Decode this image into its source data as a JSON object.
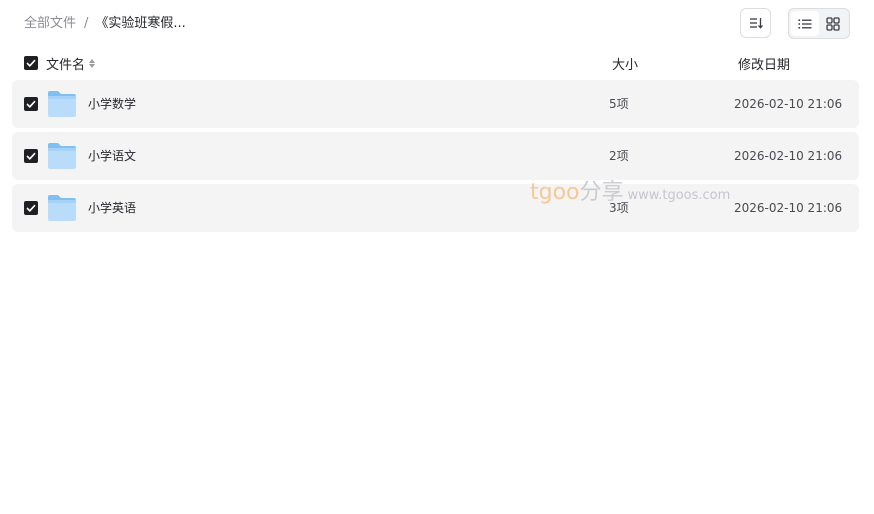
{
  "breadcrumb": {
    "root": "全部文件",
    "separator": "/",
    "current": "《实验班寒假..."
  },
  "toolbar": {
    "sort_icon": "sort-list-icon",
    "views": [
      {
        "icon": "list-view-icon",
        "active": true
      },
      {
        "icon": "grid-view-icon",
        "active": false
      }
    ]
  },
  "header": {
    "name": "文件名",
    "size": "大小",
    "date": "修改日期",
    "all_checked": true
  },
  "files": [
    {
      "name": "小学数学",
      "size": "5项",
      "date": "2026-02-10 21:06",
      "checked": true,
      "icon": "folder-icon"
    },
    {
      "name": "小学语文",
      "size": "2项",
      "date": "2026-02-10 21:06",
      "checked": true,
      "icon": "folder-icon"
    },
    {
      "name": "小学英语",
      "size": "3项",
      "date": "2026-02-10 21:06",
      "checked": true,
      "icon": "folder-icon"
    }
  ],
  "watermark": {
    "brand": "tgoo",
    "brand_cn": "分享",
    "url": "www.tgoos.com"
  },
  "colors": {
    "row_background": "#f4f4f5",
    "checkbox": "#1f2024",
    "folder_light": "#b9dcfb",
    "folder_dark": "#7fbff2"
  }
}
